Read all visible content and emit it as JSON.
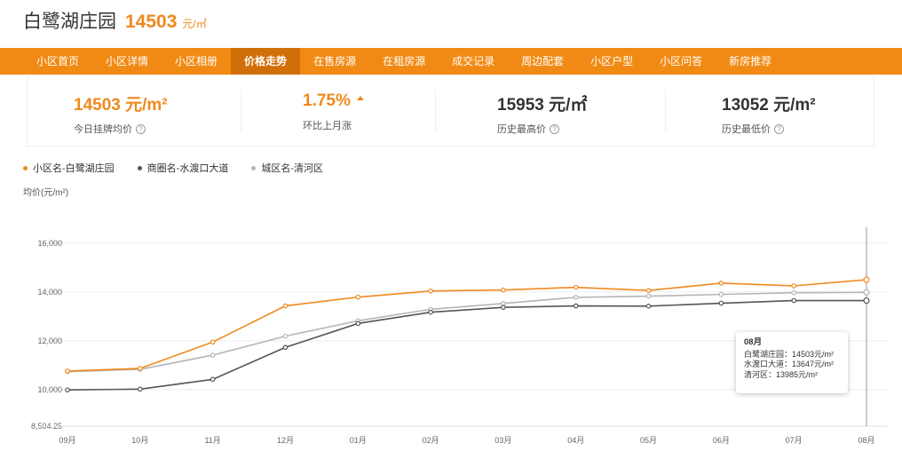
{
  "header": {
    "community_name": "白鹭湖庄园",
    "price": "14503",
    "price_unit": "元/㎡"
  },
  "nav": {
    "items": [
      "小区首页",
      "小区详情",
      "小区相册",
      "价格走势",
      "在售房源",
      "在租房源",
      "成交记录",
      "周边配套",
      "小区户型",
      "小区问答",
      "新房推荐"
    ],
    "active_index": 3
  },
  "stats": [
    {
      "value": "14503 元/m²",
      "label": "今日挂牌均价",
      "help_icon": "question-icon"
    },
    {
      "value": "1.75%",
      "label": "环比上月涨",
      "trend_icon": "up-triangle-icon"
    },
    {
      "value": "15953 元/㎡",
      "label": "历史最高价",
      "help_icon": "question-icon"
    },
    {
      "value": "13052 元/m²",
      "label": "历史最低价",
      "help_icon": "question-icon"
    }
  ],
  "colors": {
    "accent": "#f0891f",
    "nav_bg": "#f18a14",
    "nav_active": "#d06f07",
    "series_1": "#f0891f",
    "series_2": "#555555",
    "series_3": "#b5b5b5"
  },
  "chart_data": {
    "type": "line",
    "ylabel": "均价(元/m²)",
    "categories": [
      "09月",
      "10月",
      "11月",
      "12月",
      "01月",
      "02月",
      "03月",
      "04月",
      "05月",
      "06月",
      "07月",
      "08月"
    ],
    "yticks": [
      "8,504.25",
      "10,000",
      "12,000",
      "14,000",
      "16,000"
    ],
    "ylim": [
      8504.25,
      16900
    ],
    "series": [
      {
        "name": "小区名-白鹭湖庄园",
        "color": "#f0891f",
        "values": [
          10760,
          10870,
          11950,
          13430,
          13790,
          14040,
          14080,
          14190,
          14060,
          14360,
          14250,
          14503
        ]
      },
      {
        "name": "商圈名-水渡口大道",
        "color": "#555555",
        "values": [
          9990,
          10020,
          10420,
          11730,
          12710,
          13170,
          13370,
          13430,
          13420,
          13540,
          13650,
          13647
        ]
      },
      {
        "name": "城区名-清河区",
        "color": "#b5b5b5",
        "values": [
          10740,
          10830,
          11410,
          12190,
          12820,
          13290,
          13530,
          13780,
          13830,
          13900,
          13970,
          13985
        ]
      }
    ],
    "tooltip": {
      "title": "08月",
      "lines": [
        "白鹭湖庄园：14503元/m²",
        "水渡口大道：13647元/m²",
        "清河区：13985元/m²"
      ]
    },
    "grid": true,
    "legend_position": "top-left"
  }
}
